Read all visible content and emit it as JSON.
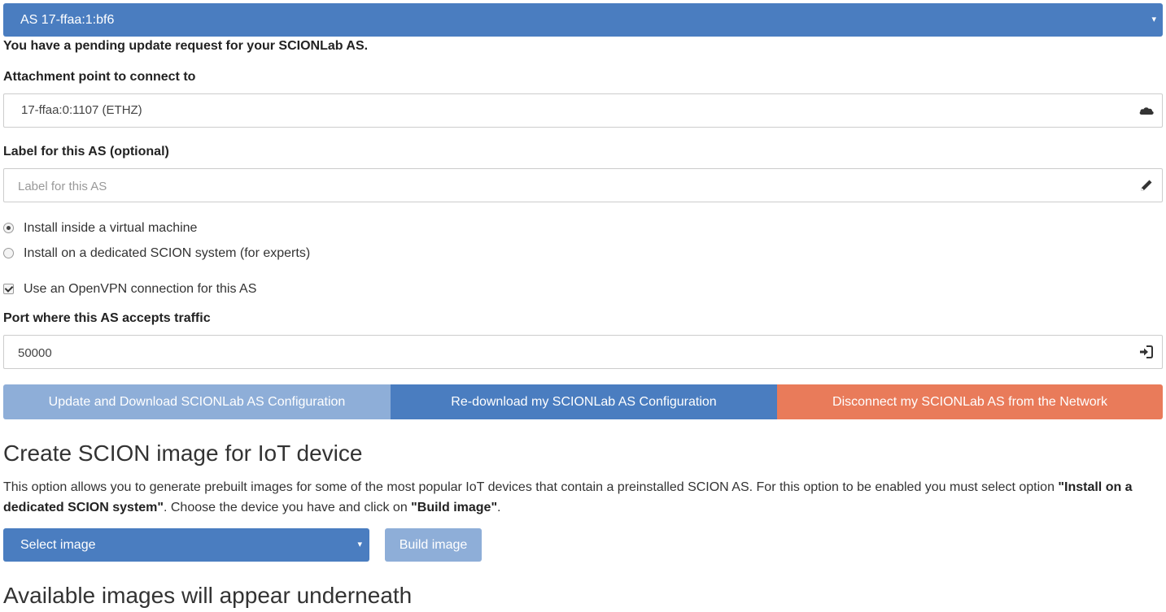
{
  "as_selector": {
    "value": "AS 17-ffaa:1:bf6",
    "caret": "▾"
  },
  "notice": "You have a pending update request for your SCIONLab AS.",
  "attachment": {
    "label": "Attachment point to connect to",
    "value": "17-ffaa:0:1107 (ETHZ)",
    "icon": "cloud-icon"
  },
  "as_label": {
    "label": "Label for this AS (optional)",
    "placeholder": "Label for this AS",
    "icon": "pencil-icon"
  },
  "install_options": [
    {
      "label": "Install inside a virtual machine",
      "selected": true
    },
    {
      "label": "Install on a dedicated SCION system (for experts)",
      "selected": false
    }
  ],
  "openvpn": {
    "label": "Use an OpenVPN connection for this AS",
    "checked": true
  },
  "port": {
    "label": "Port where this AS accepts traffic",
    "value": "50000",
    "icon": "sign-in-icon"
  },
  "actions": {
    "update": "Update and Download SCIONLab AS Configuration",
    "redownload": "Re-download my SCIONLab AS Configuration",
    "disconnect": "Disconnect my SCIONLab AS from the Network"
  },
  "iot": {
    "title": "Create SCION image for IoT device",
    "desc_1": "This option allows you to generate prebuilt images for some of the most popular IoT devices that contain a preinstalled SCION AS. For this option to be enabled you must select option ",
    "desc_bold_1": "\"Install on a dedicated SCION system\"",
    "desc_2": ". Choose the device you have and click on ",
    "desc_bold_2": "\"Build image\"",
    "desc_3": ".",
    "select_label": "Select image",
    "build_label": "Build image",
    "available_title": "Available images will appear underneath"
  },
  "colors": {
    "primary": "#4a7dc0",
    "primary_disabled": "#8eaed8",
    "danger": "#e97b5a"
  }
}
